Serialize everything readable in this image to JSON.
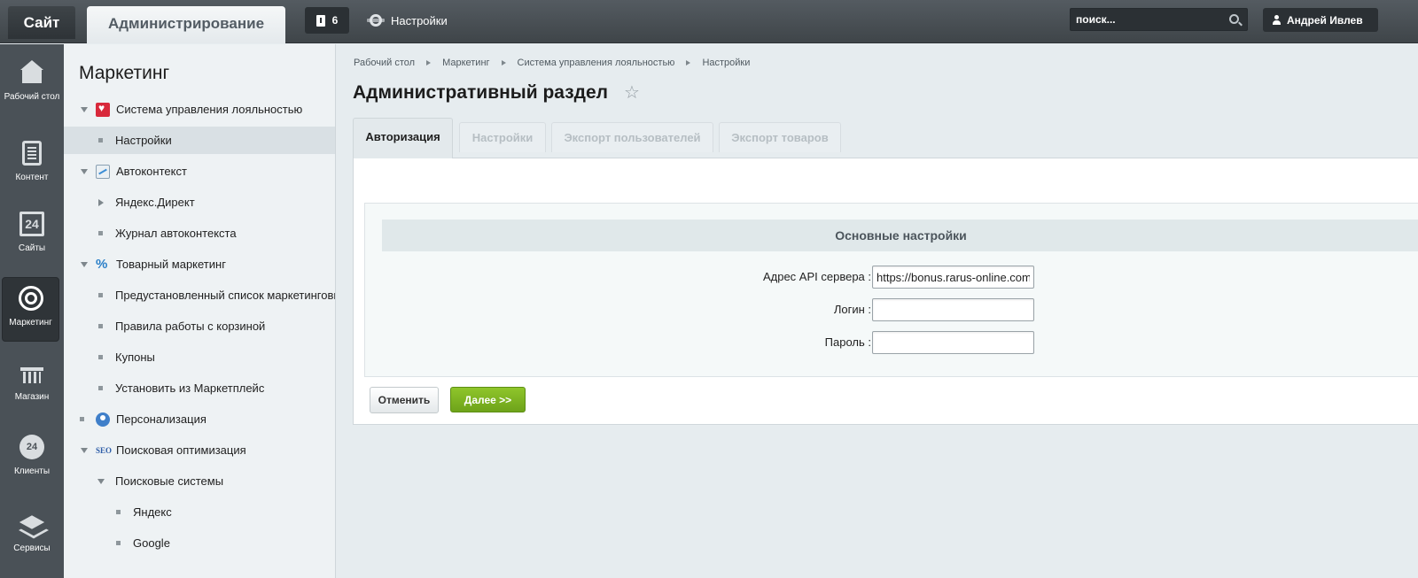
{
  "topbar": {
    "site_tab": "Сайт",
    "admin_tab": "Администрирование",
    "notifications_count": "6",
    "settings_label": "Настройки",
    "search_placeholder": "поиск...",
    "user_name": "Андрей Ивлев"
  },
  "rail": {
    "items": [
      {
        "label": "Рабочий стол",
        "icon": "home-icon"
      },
      {
        "label": "Контент",
        "icon": "document-icon"
      },
      {
        "label": "Сайты",
        "icon": "calendar-24-icon",
        "glyph": "24"
      },
      {
        "label": "Маркетинг",
        "icon": "target-icon",
        "active": true
      },
      {
        "label": "Магазин",
        "icon": "basket-icon"
      },
      {
        "label": "Клиенты",
        "icon": "clients-24-icon",
        "glyph": "24"
      },
      {
        "label": "Сервисы",
        "icon": "layers-icon"
      }
    ]
  },
  "menu": {
    "title": "Маркетинг",
    "items": [
      {
        "label": "Система управления лояльностью"
      },
      {
        "label": "Настройки"
      },
      {
        "label": "Автоконтекст"
      },
      {
        "label": "Яндекс.Директ"
      },
      {
        "label": "Журнал автоконтекста"
      },
      {
        "label": "Товарный маркетинг"
      },
      {
        "label": "Предустановленный список маркетинговых"
      },
      {
        "label": "Правила работы с корзиной"
      },
      {
        "label": "Купоны"
      },
      {
        "label": "Установить из Маркетплейс"
      },
      {
        "label": "Персонализация"
      },
      {
        "label": "Поисковая оптимизация"
      },
      {
        "label": "Поисковые системы"
      },
      {
        "label": "Яндекс"
      },
      {
        "label": "Google"
      }
    ]
  },
  "breadcrumb": [
    "Рабочий стол",
    "Маркетинг",
    "Система управления лояльностью",
    "Настройки"
  ],
  "page_title": "Административный раздел",
  "tabs": [
    "Авторизация",
    "Настройки",
    "Экспорт пользователей",
    "Экспорт товаров"
  ],
  "form": {
    "section_title": "Основные настройки",
    "api_label": "Адрес API сервера :",
    "api_value": "https://bonus.rarus-online.com",
    "login_label": "Логин :",
    "login_value": "",
    "password_label": "Пароль :",
    "password_value": ""
  },
  "buttons": {
    "cancel": "Отменить",
    "next": "Далее >>"
  },
  "colors": {
    "topbar": "#4a5157",
    "rail": "#4a5157",
    "next_button": "#7cb324",
    "favorite_star": "#939ca2",
    "loyalty_icon": "#d8293b"
  }
}
